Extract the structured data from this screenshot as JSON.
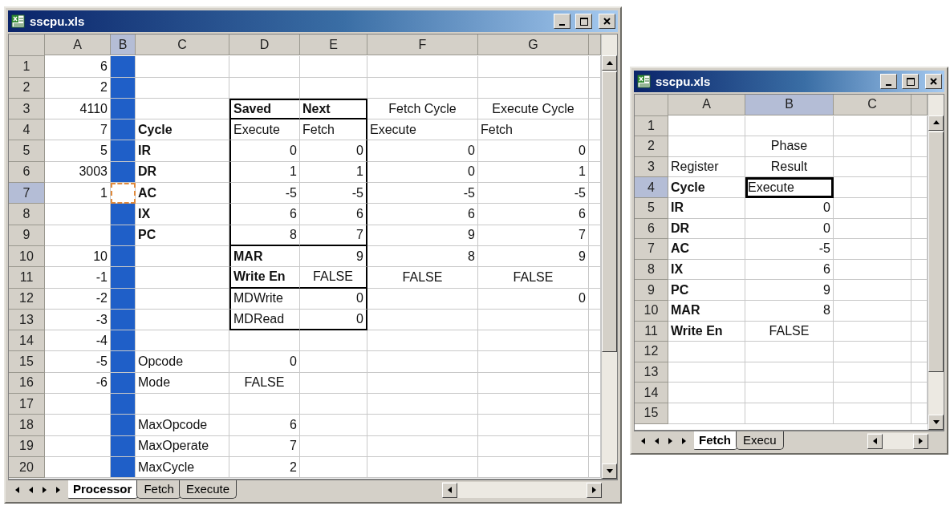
{
  "windows": [
    {
      "title": "sscpu.xls",
      "marquee": true,
      "columns": [
        {
          "label": "A",
          "selected": false,
          "filled": false
        },
        {
          "label": "B",
          "selected": true,
          "filled": true
        },
        {
          "label": "C",
          "selected": false,
          "filled": false
        },
        {
          "label": "D",
          "selected": false,
          "filled": false
        },
        {
          "label": "E",
          "selected": false,
          "filled": false
        },
        {
          "label": "F",
          "selected": false,
          "filled": false
        },
        {
          "label": "G",
          "selected": false,
          "filled": false
        }
      ],
      "rows": [
        {
          "label": "1",
          "selected": false,
          "cells": [
            {
              "text": "6",
              "kind": "number",
              "active": false
            },
            {
              "active": false
            },
            {
              "active": false
            },
            {
              "active": false
            },
            {
              "active": false
            },
            {
              "active": false
            },
            {
              "active": false
            }
          ]
        },
        {
          "label": "2",
          "selected": false,
          "cells": [
            {
              "text": "2",
              "kind": "number",
              "active": false
            },
            {
              "active": false
            },
            {
              "active": false
            },
            {
              "active": false
            },
            {
              "active": false
            },
            {
              "active": false
            },
            {
              "active": false
            }
          ]
        },
        {
          "label": "3",
          "selected": false,
          "cells": [
            {
              "text": "4110",
              "kind": "number",
              "active": false
            },
            {
              "active": false
            },
            {
              "active": false
            },
            {
              "text": "Saved",
              "kind": "bold-label",
              "active": false
            },
            {
              "text": "Next",
              "kind": "bold-label",
              "active": false
            },
            {
              "text": "Fetch Cycle",
              "kind": "centered",
              "active": false
            },
            {
              "text": "Execute Cycle",
              "kind": "centered",
              "active": false
            }
          ]
        },
        {
          "label": "4",
          "selected": false,
          "cells": [
            {
              "text": "7",
              "kind": "number",
              "active": false
            },
            {
              "active": false
            },
            {
              "text": "Cycle",
              "kind": "bold-label",
              "active": false
            },
            {
              "text": "Execute",
              "kind": "label",
              "active": false
            },
            {
              "text": "Fetch",
              "kind": "label",
              "active": false
            },
            {
              "text": "Execute",
              "kind": "label",
              "active": false
            },
            {
              "text": "Fetch",
              "kind": "label",
              "active": false
            }
          ]
        },
        {
          "label": "5",
          "selected": false,
          "cells": [
            {
              "text": "5",
              "kind": "number",
              "active": false
            },
            {
              "active": false
            },
            {
              "text": "IR",
              "kind": "bold-label",
              "active": false
            },
            {
              "text": "0",
              "kind": "number",
              "active": false
            },
            {
              "text": "0",
              "kind": "number",
              "active": false
            },
            {
              "text": "0",
              "kind": "number",
              "active": false
            },
            {
              "text": "0",
              "kind": "number",
              "active": false
            }
          ]
        },
        {
          "label": "6",
          "selected": false,
          "cells": [
            {
              "text": "3003",
              "kind": "number",
              "active": false
            },
            {
              "active": false
            },
            {
              "text": "DR",
              "kind": "bold-label",
              "active": false
            },
            {
              "text": "1",
              "kind": "number",
              "active": false
            },
            {
              "text": "1",
              "kind": "number",
              "active": false
            },
            {
              "text": "0",
              "kind": "number",
              "active": false
            },
            {
              "text": "1",
              "kind": "number",
              "active": false
            }
          ]
        },
        {
          "label": "7",
          "selected": true,
          "cells": [
            {
              "text": "1",
              "kind": "number",
              "active": false
            },
            {
              "active": true
            },
            {
              "text": "AC",
              "kind": "bold-label",
              "active": false
            },
            {
              "text": "-5",
              "kind": "number",
              "active": false
            },
            {
              "text": "-5",
              "kind": "number",
              "active": false
            },
            {
              "text": "-5",
              "kind": "number",
              "active": false
            },
            {
              "text": "-5",
              "kind": "number",
              "active": false
            }
          ]
        },
        {
          "label": "8",
          "selected": false,
          "cells": [
            {
              "active": false
            },
            {
              "active": false
            },
            {
              "text": "IX",
              "kind": "bold-label",
              "active": false
            },
            {
              "text": "6",
              "kind": "number",
              "active": false
            },
            {
              "text": "6",
              "kind": "number",
              "active": false
            },
            {
              "text": "6",
              "kind": "number",
              "active": false
            },
            {
              "text": "6",
              "kind": "number",
              "active": false
            }
          ]
        },
        {
          "label": "9",
          "selected": false,
          "cells": [
            {
              "active": false
            },
            {
              "active": false
            },
            {
              "text": "PC",
              "kind": "bold-label",
              "active": false
            },
            {
              "text": "8",
              "kind": "number",
              "active": false
            },
            {
              "text": "7",
              "kind": "number",
              "active": false
            },
            {
              "text": "9",
              "kind": "number",
              "active": false
            },
            {
              "text": "7",
              "kind": "number",
              "active": false
            }
          ]
        },
        {
          "label": "10",
          "selected": false,
          "cells": [
            {
              "text": "10",
              "kind": "number",
              "active": false
            },
            {
              "active": false
            },
            {
              "active": false
            },
            {
              "text": "MAR",
              "kind": "bold-label",
              "active": false
            },
            {
              "text": "9",
              "kind": "number",
              "active": false
            },
            {
              "text": "8",
              "kind": "number",
              "active": false
            },
            {
              "text": "9",
              "kind": "number",
              "active": false
            }
          ]
        },
        {
          "label": "11",
          "selected": false,
          "cells": [
            {
              "text": "-1",
              "kind": "number",
              "active": false
            },
            {
              "active": false
            },
            {
              "active": false
            },
            {
              "text": "Write En",
              "kind": "bold-label",
              "active": false
            },
            {
              "text": "FALSE",
              "kind": "centered",
              "active": false
            },
            {
              "text": "FALSE",
              "kind": "centered",
              "active": false
            },
            {
              "text": "FALSE",
              "kind": "centered",
              "active": false
            }
          ]
        },
        {
          "label": "12",
          "selected": false,
          "cells": [
            {
              "text": "-2",
              "kind": "number",
              "active": false
            },
            {
              "active": false
            },
            {
              "active": false
            },
            {
              "text": "MDWrite",
              "kind": "label",
              "active": false
            },
            {
              "text": "0",
              "kind": "number",
              "active": false
            },
            {
              "active": false
            },
            {
              "text": "0",
              "kind": "number",
              "active": false
            }
          ]
        },
        {
          "label": "13",
          "selected": false,
          "cells": [
            {
              "text": "-3",
              "kind": "number",
              "active": false
            },
            {
              "active": false
            },
            {
              "active": false
            },
            {
              "text": "MDRead",
              "kind": "label",
              "active": false
            },
            {
              "text": "0",
              "kind": "number",
              "active": false
            },
            {
              "active": false
            },
            {
              "active": false
            }
          ]
        },
        {
          "label": "14",
          "selected": false,
          "cells": [
            {
              "text": "-4",
              "kind": "number",
              "active": false
            },
            {
              "active": false
            },
            {
              "active": false
            },
            {
              "active": false
            },
            {
              "active": false
            },
            {
              "active": false
            },
            {
              "active": false
            }
          ]
        },
        {
          "label": "15",
          "selected": false,
          "cells": [
            {
              "text": "-5",
              "kind": "number",
              "active": false
            },
            {
              "active": false
            },
            {
              "text": "Opcode",
              "kind": "label",
              "active": false
            },
            {
              "text": "0",
              "kind": "number",
              "active": false
            },
            {
              "active": false
            },
            {
              "active": false
            },
            {
              "active": false
            }
          ]
        },
        {
          "label": "16",
          "selected": false,
          "cells": [
            {
              "text": "-6",
              "kind": "number",
              "active": false
            },
            {
              "active": false
            },
            {
              "text": "Mode",
              "kind": "label",
              "active": false
            },
            {
              "text": "FALSE",
              "kind": "centered",
              "active": false
            },
            {
              "active": false
            },
            {
              "active": false
            },
            {
              "active": false
            }
          ]
        },
        {
          "label": "17",
          "selected": false,
          "cells": [
            {
              "active": false
            },
            {
              "active": false
            },
            {
              "active": false
            },
            {
              "active": false
            },
            {
              "active": false
            },
            {
              "active": false
            },
            {
              "active": false
            }
          ]
        },
        {
          "label": "18",
          "selected": false,
          "cells": [
            {
              "active": false
            },
            {
              "active": false
            },
            {
              "text": "MaxOpcode",
              "kind": "label",
              "active": false
            },
            {
              "text": "6",
              "kind": "number",
              "active": false
            },
            {
              "active": false
            },
            {
              "active": false
            },
            {
              "active": false
            }
          ]
        },
        {
          "label": "19",
          "selected": false,
          "cells": [
            {
              "active": false
            },
            {
              "active": false
            },
            {
              "text": "MaxOperate",
              "kind": "label",
              "active": false
            },
            {
              "text": "7",
              "kind": "number",
              "active": false
            },
            {
              "active": false
            },
            {
              "active": false
            },
            {
              "active": false
            }
          ]
        },
        {
          "label": "20",
          "selected": false,
          "cells": [
            {
              "active": false
            },
            {
              "active": false
            },
            {
              "text": "MaxCycle",
              "kind": "label",
              "active": false
            },
            {
              "text": "2",
              "kind": "number",
              "active": false
            },
            {
              "active": false
            },
            {
              "active": false
            },
            {
              "active": false
            }
          ]
        }
      ],
      "sheet_tabs": [
        {
          "label": "Processor",
          "selected": true
        },
        {
          "label": "Fetch",
          "selected": false
        },
        {
          "label": "Execute",
          "selected": false
        }
      ]
    },
    {
      "title": "sscpu.xls",
      "marquee": false,
      "columns": [
        {
          "label": "A",
          "selected": false,
          "filled": false
        },
        {
          "label": "B",
          "selected": true,
          "filled": false
        },
        {
          "label": "C",
          "selected": false,
          "filled": false
        }
      ],
      "rows": [
        {
          "label": "1",
          "selected": false,
          "cells": [
            {
              "active": false
            },
            {
              "active": false
            },
            {
              "active": false
            }
          ]
        },
        {
          "label": "2",
          "selected": false,
          "cells": [
            {
              "active": false
            },
            {
              "text": "Phase",
              "kind": "centered",
              "active": false
            },
            {
              "active": false
            }
          ]
        },
        {
          "label": "3",
          "selected": false,
          "cells": [
            {
              "text": "Register",
              "kind": "label",
              "active": false
            },
            {
              "text": "Result",
              "kind": "centered",
              "active": false
            },
            {
              "active": false
            }
          ]
        },
        {
          "label": "4",
          "selected": true,
          "cells": [
            {
              "text": "Cycle",
              "kind": "bold-label",
              "active": false
            },
            {
              "text": "Execute",
              "kind": "label",
              "active": true
            },
            {
              "active": false
            }
          ]
        },
        {
          "label": "5",
          "selected": false,
          "cells": [
            {
              "text": "IR",
              "kind": "bold-label",
              "active": false
            },
            {
              "text": "0",
              "kind": "number",
              "active": false
            },
            {
              "active": false
            }
          ]
        },
        {
          "label": "6",
          "selected": false,
          "cells": [
            {
              "text": "DR",
              "kind": "bold-label",
              "active": false
            },
            {
              "text": "0",
              "kind": "number",
              "active": false
            },
            {
              "active": false
            }
          ]
        },
        {
          "label": "7",
          "selected": false,
          "cells": [
            {
              "text": "AC",
              "kind": "bold-label",
              "active": false
            },
            {
              "text": "-5",
              "kind": "number",
              "active": false
            },
            {
              "active": false
            }
          ]
        },
        {
          "label": "8",
          "selected": false,
          "cells": [
            {
              "text": "IX",
              "kind": "bold-label",
              "active": false
            },
            {
              "text": "6",
              "kind": "number",
              "active": false
            },
            {
              "active": false
            }
          ]
        },
        {
          "label": "9",
          "selected": false,
          "cells": [
            {
              "text": "PC",
              "kind": "bold-label",
              "active": false
            },
            {
              "text": "9",
              "kind": "number",
              "active": false
            },
            {
              "active": false
            }
          ]
        },
        {
          "label": "10",
          "selected": false,
          "cells": [
            {
              "text": "MAR",
              "kind": "bold-label",
              "active": false
            },
            {
              "text": "8",
              "kind": "number",
              "active": false
            },
            {
              "active": false
            }
          ]
        },
        {
          "label": "11",
          "selected": false,
          "cells": [
            {
              "text": "Write En",
              "kind": "bold-label",
              "active": false
            },
            {
              "text": "FALSE",
              "kind": "centered",
              "active": false
            },
            {
              "active": false
            }
          ]
        },
        {
          "label": "12",
          "selected": false,
          "cells": [
            {
              "active": false
            },
            {
              "active": false
            },
            {
              "active": false
            }
          ]
        },
        {
          "label": "13",
          "selected": false,
          "cells": [
            {
              "active": false
            },
            {
              "active": false
            },
            {
              "active": false
            }
          ]
        },
        {
          "label": "14",
          "selected": false,
          "cells": [
            {
              "active": false
            },
            {
              "active": false
            },
            {
              "active": false
            }
          ]
        },
        {
          "label": "15",
          "selected": false,
          "cells": [
            {
              "active": false
            },
            {
              "active": false
            },
            {
              "active": false
            }
          ]
        }
      ],
      "sheet_tabs": [
        {
          "label": "Fetch",
          "selected": true
        },
        {
          "label": "Execu",
          "selected": false
        }
      ]
    }
  ]
}
